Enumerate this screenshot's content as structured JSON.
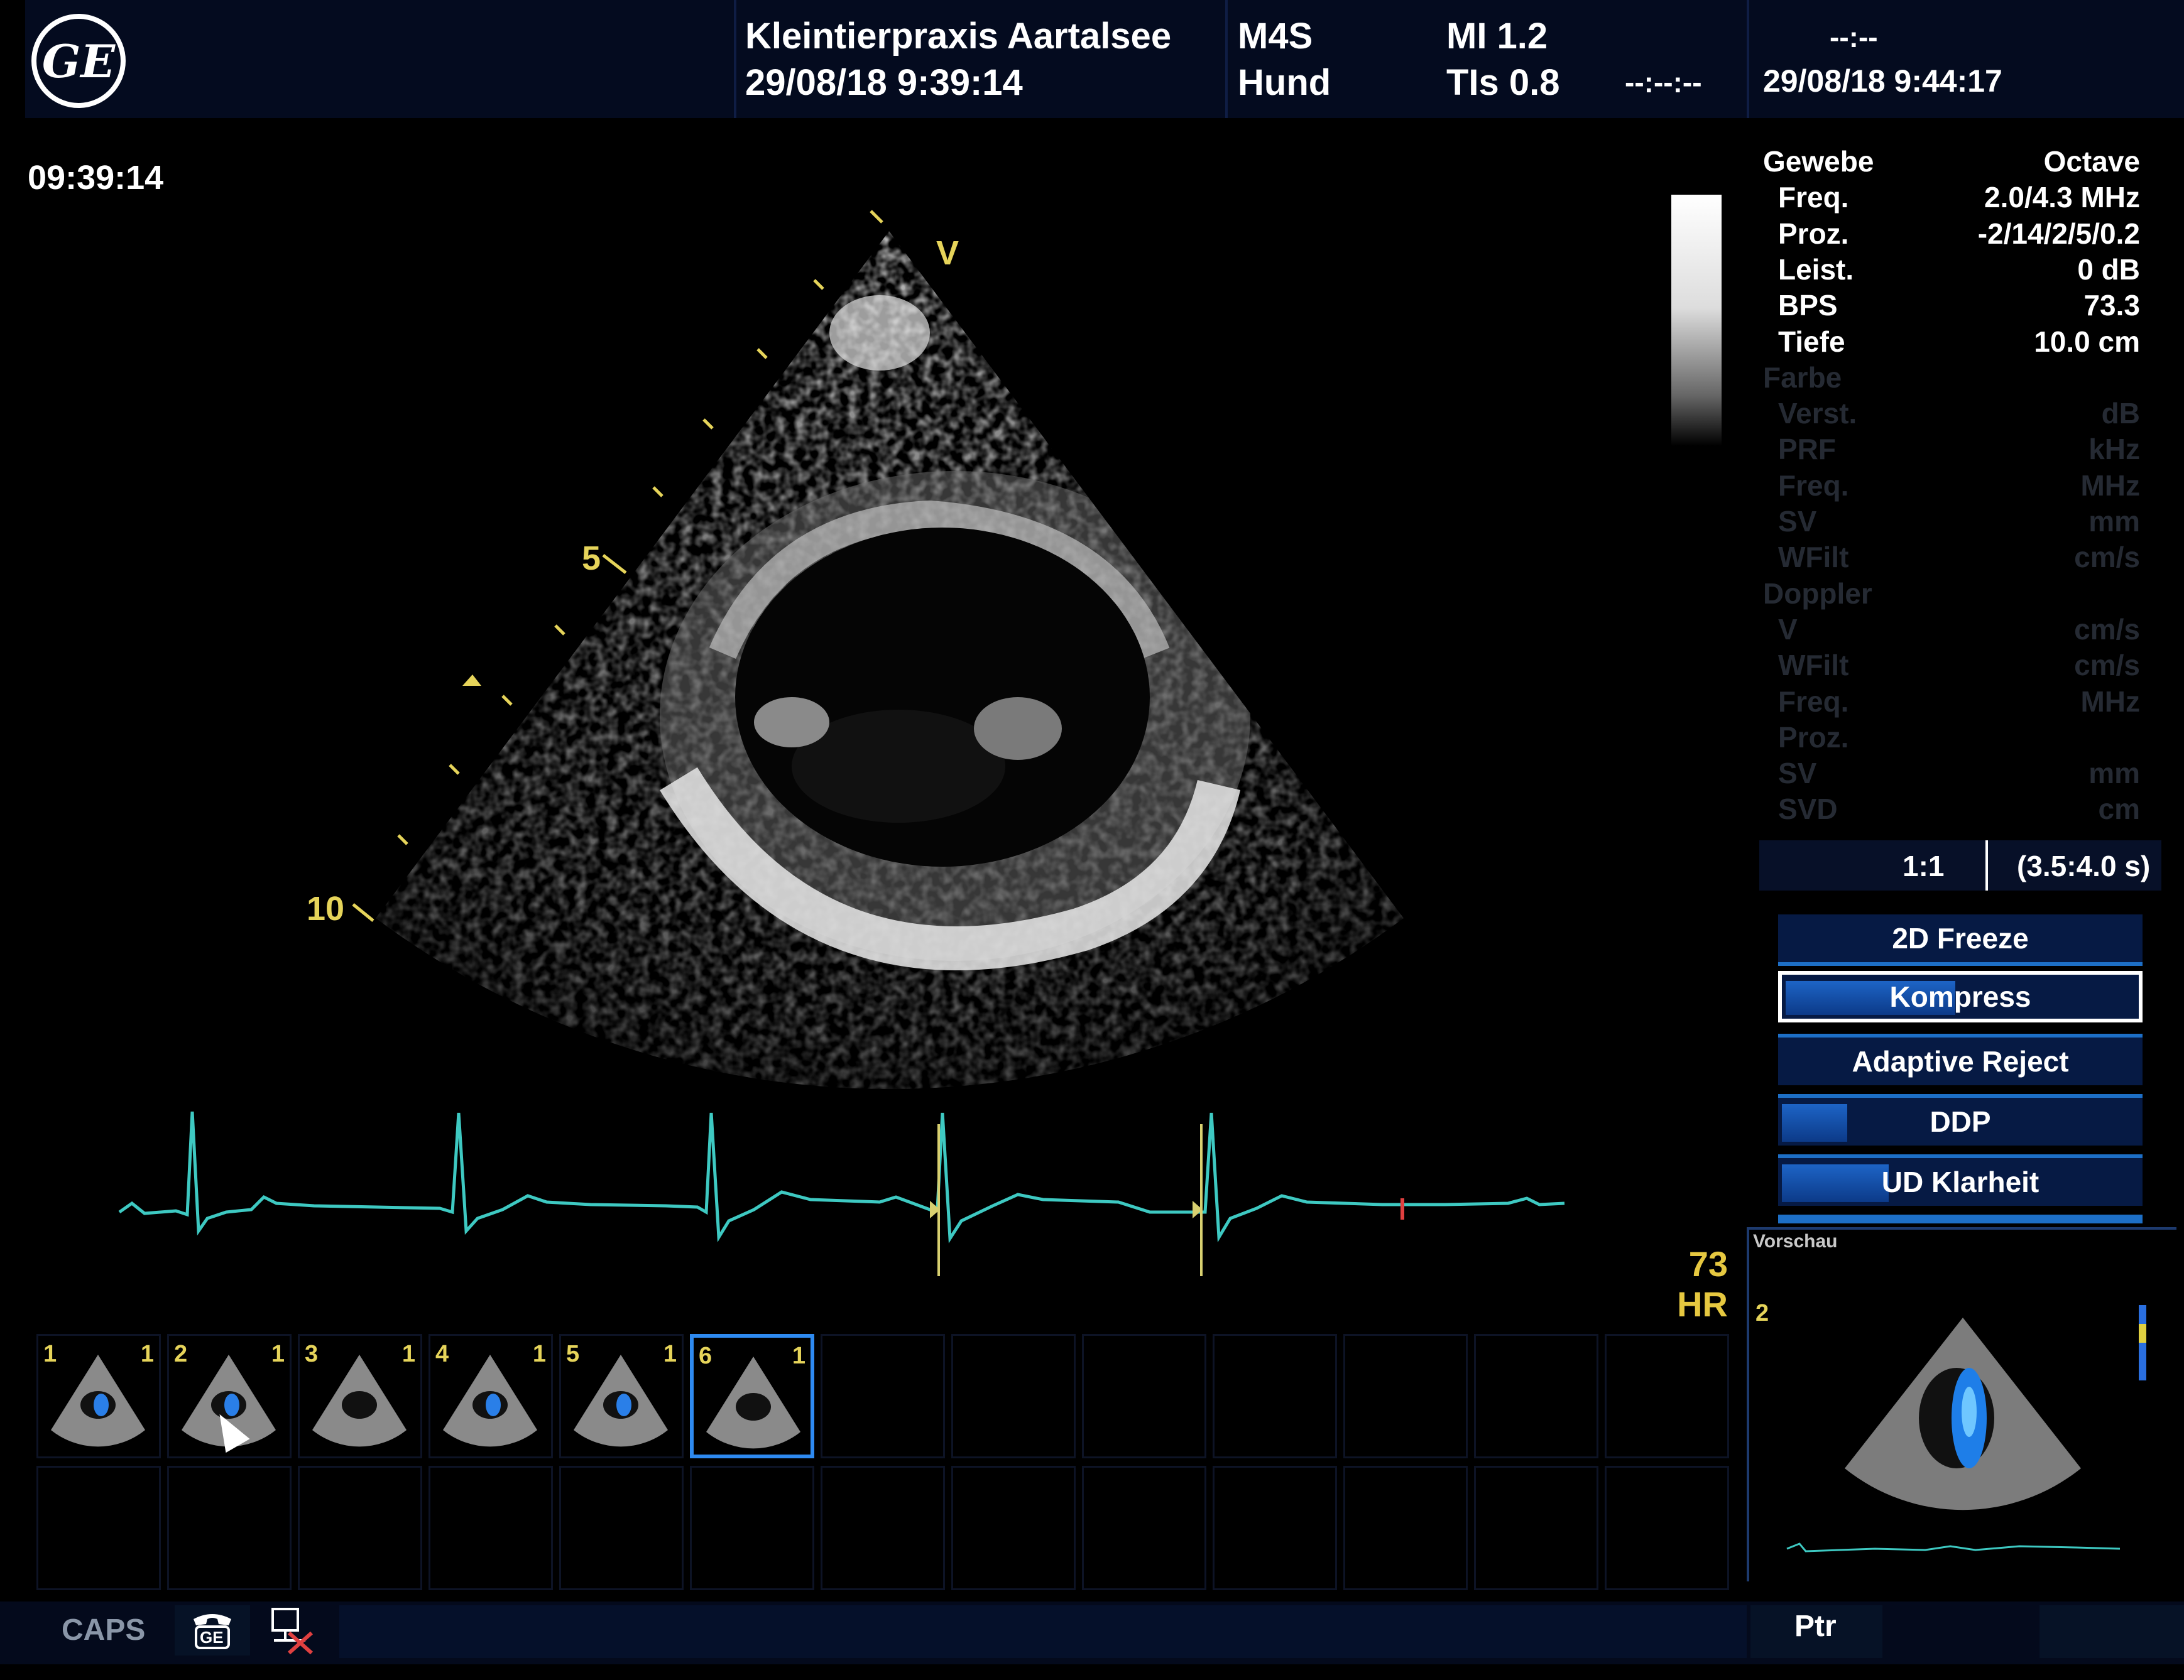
{
  "header": {
    "clinic": "Kleintierpraxis Aartalsee",
    "start_datetime": "29/08/18 9:39:14",
    "probe": "M4S",
    "species": "Hund",
    "mi": "MI 1.2",
    "tis": "TIs 0.8",
    "timer_a": "--:--",
    "timer_b": "--:--:--",
    "current_datetime": "29/08/18 9:44:17",
    "logo": "GE"
  },
  "image_clock": "09:39:14",
  "depth_marks": {
    "top": "V",
    "mid": "5",
    "bottom": "10"
  },
  "params": [
    {
      "label": "Gewebe",
      "value": "Octave",
      "active": true
    },
    {
      "label": "Freq.",
      "value": "2.0/4.3  MHz",
      "active": true
    },
    {
      "label": "Proz.",
      "value": "-2/14/2/5/0.2",
      "active": true
    },
    {
      "label": "Leist.",
      "value": "0  dB",
      "active": true
    },
    {
      "label": "BPS",
      "value": "73.3",
      "active": true
    },
    {
      "label": "Tiefe",
      "value": "10.0  cm",
      "active": true
    },
    {
      "label": "Farbe",
      "value": "",
      "active": false
    },
    {
      "label": "Verst.",
      "value": "dB",
      "active": false
    },
    {
      "label": "PRF",
      "value": "kHz",
      "active": false
    },
    {
      "label": "Freq.",
      "value": "MHz",
      "active": false
    },
    {
      "label": "SV",
      "value": "mm",
      "active": false
    },
    {
      "label": "WFilt",
      "value": "cm/s",
      "active": false
    },
    {
      "label": "Doppler",
      "value": "",
      "active": false
    },
    {
      "label": "V",
      "value": "cm/s",
      "active": false
    },
    {
      "label": "WFilt",
      "value": "cm/s",
      "active": false
    },
    {
      "label": "Freq.",
      "value": "MHz",
      "active": false
    },
    {
      "label": "Proz.",
      "value": "",
      "active": false
    },
    {
      "label": "SV",
      "value": "mm",
      "active": false
    },
    {
      "label": "SVD",
      "value": "cm",
      "active": false
    }
  ],
  "playback": {
    "ratio": "1:1",
    "range": "(3.5:4.0 s)"
  },
  "buttons": {
    "freeze": "2D Freeze",
    "kompress": "Kompress",
    "adaptive": "Adaptive Reject",
    "ddp": "DDP",
    "ud_prefix": "UD",
    "klarheit": "Klarheit"
  },
  "hr": {
    "value": "73",
    "label": "HR"
  },
  "thumbnails": [
    {
      "index": "1",
      "count": "1",
      "color": true
    },
    {
      "index": "2",
      "count": "1",
      "color": true
    },
    {
      "index": "3",
      "count": "1",
      "color": false
    },
    {
      "index": "4",
      "count": "1",
      "color": true
    },
    {
      "index": "5",
      "count": "1",
      "color": true
    },
    {
      "index": "6",
      "count": "1",
      "color": false,
      "selected": true
    }
  ],
  "preview": {
    "title": "Vorschau",
    "index": "2"
  },
  "status": {
    "caps": "CAPS",
    "ptr": "Ptr",
    "phone_icon_text": "GE"
  },
  "colors": {
    "ecg": "#3ec9c2",
    "marker": "#e6d45a",
    "accent": "#1d6fc6",
    "header_bg": "#040b1f"
  }
}
